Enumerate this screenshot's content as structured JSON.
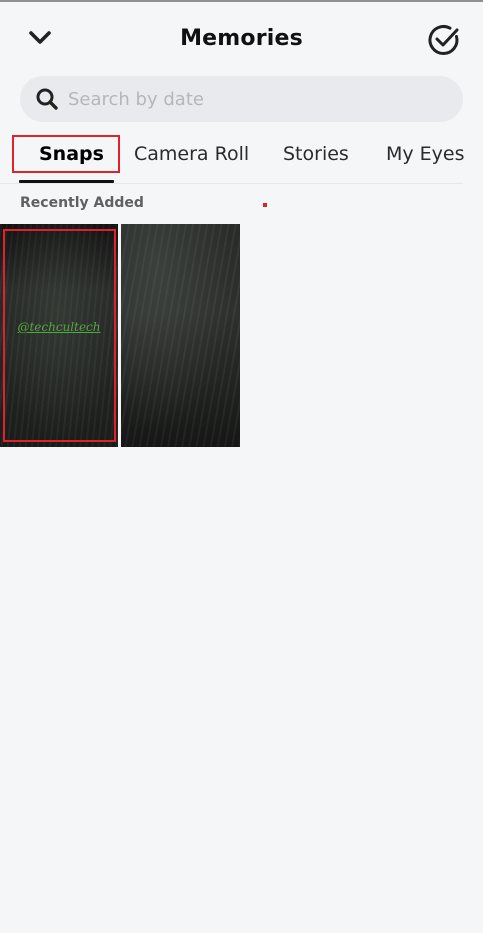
{
  "header": {
    "title": "Memories",
    "back_icon": "chevron-down-icon",
    "select_icon": "check-circle-icon"
  },
  "search": {
    "placeholder": "Search by date",
    "value": "",
    "icon": "search-icon"
  },
  "tabs": [
    {
      "label": "Snaps",
      "active": true
    },
    {
      "label": "Camera Roll",
      "active": false
    },
    {
      "label": "Stories",
      "active": false
    },
    {
      "label": "My Eyes",
      "active": false
    }
  ],
  "section": {
    "label": "Recently Added"
  },
  "thumbnails": [
    {
      "watermark": "@techcultech",
      "highlighted": true
    },
    {
      "watermark": "",
      "highlighted": false
    }
  ],
  "colors": {
    "background": "#f5f6f8",
    "highlight": "#e0222b",
    "search_bg": "#e9eaed",
    "watermark": "#4fa83c"
  }
}
